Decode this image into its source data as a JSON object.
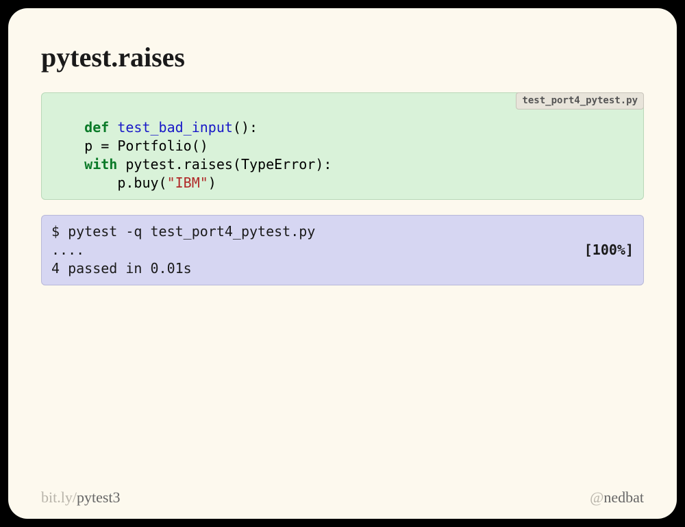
{
  "title": "pytest.raises",
  "code_block": {
    "filename": "test_port4_pytest.py",
    "line1_kw": "def",
    "line1_fn": " test_bad_input",
    "line1_rest": "():",
    "line2": "    p = Portfolio()",
    "line3_indent": "    ",
    "line3_kw": "with",
    "line3_mid": " pytest.raises(TypeError):",
    "line4_indent": "        p.buy(",
    "line4_str": "\"IBM\"",
    "line4_end": ")"
  },
  "output_block": {
    "line1": "$ pytest -q test_port4_pytest.py",
    "line2_left": "....",
    "line2_right": "[100%]",
    "line3": "4 passed in 0.01s"
  },
  "footer": {
    "left_muted": "bit.ly/",
    "left_dark": "pytest3",
    "right_muted": "@",
    "right_dark": "nedbat"
  }
}
